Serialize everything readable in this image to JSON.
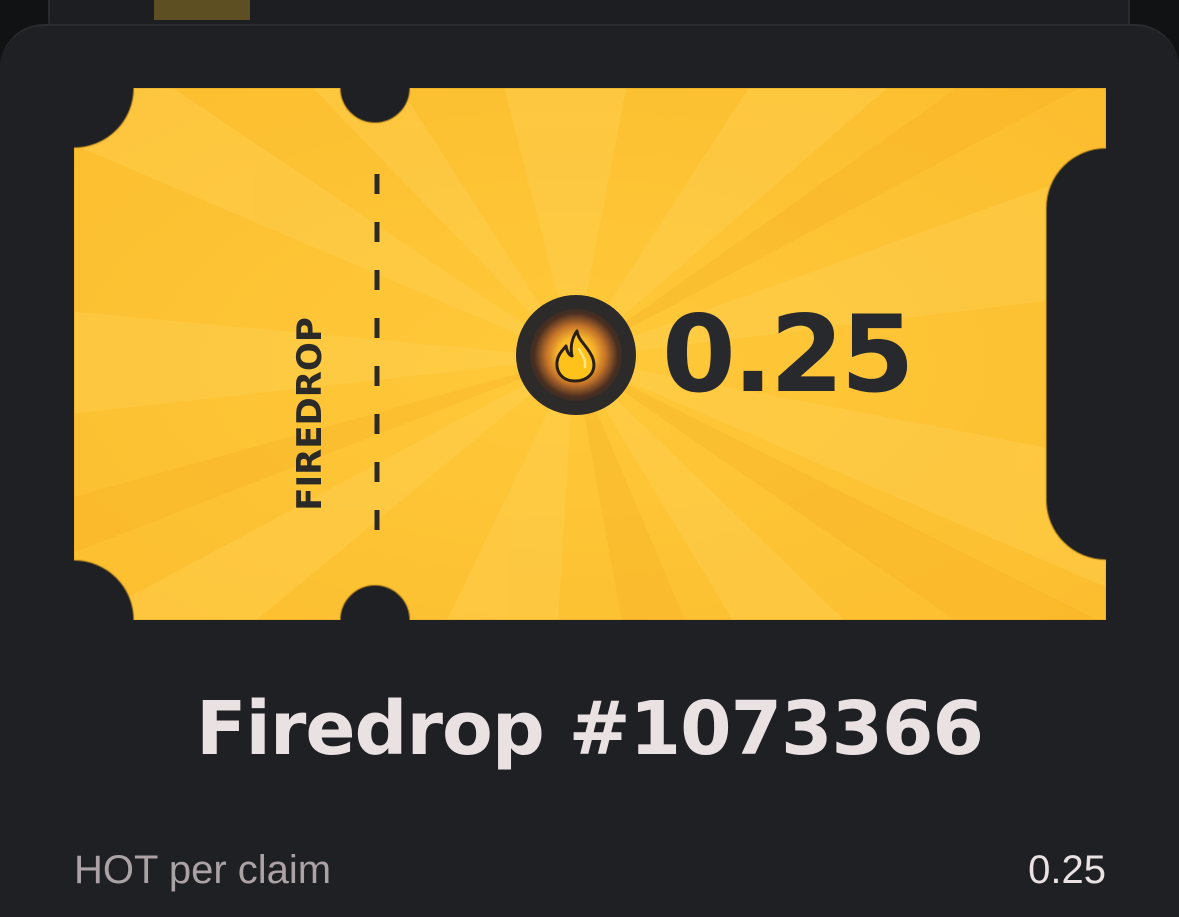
{
  "ticket": {
    "stub_label": "FIREDROP",
    "amount": "0.25",
    "coin_icon": "flame-icon"
  },
  "title": "Firedrop #1073366",
  "details": [
    {
      "label": "HOT per claim",
      "value": "0.25"
    }
  ],
  "colors": {
    "ticket_yellow": "#fbc02d",
    "background": "#1f2023",
    "title_text": "#eae1e3",
    "muted_text": "#aaa2a4"
  }
}
